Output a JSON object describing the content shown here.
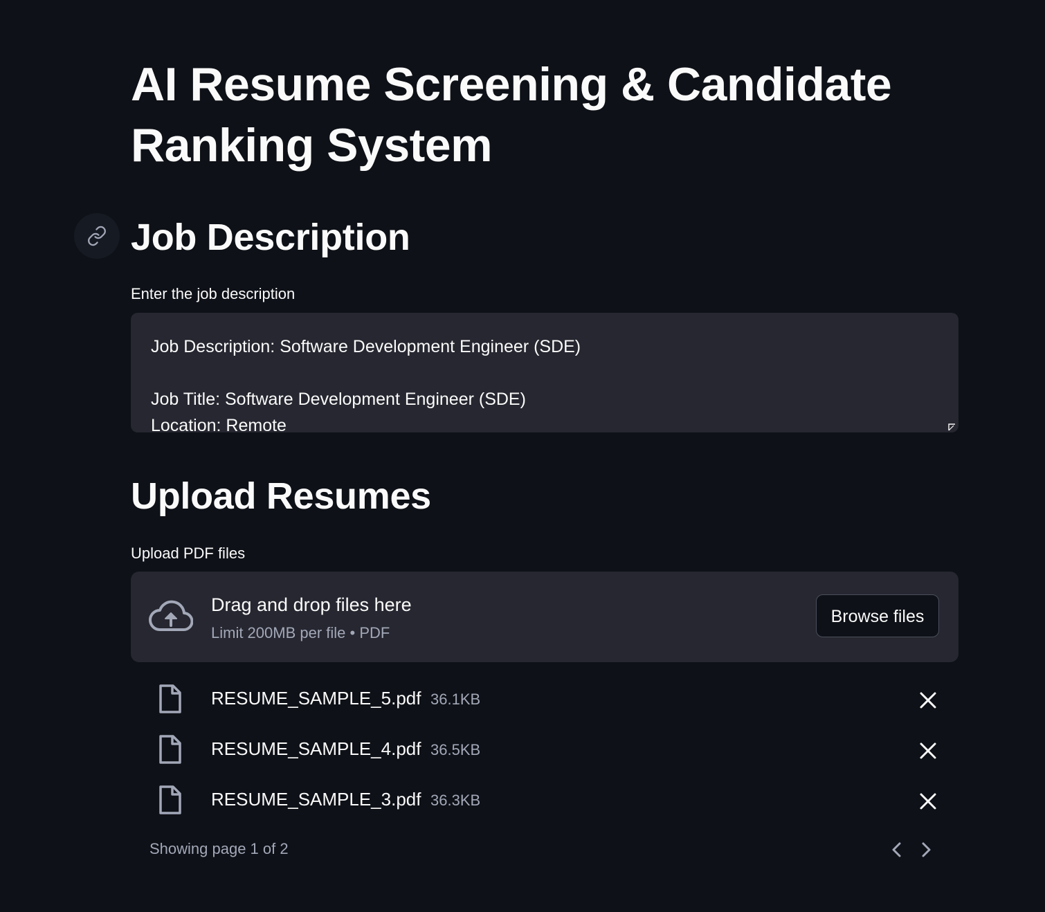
{
  "app": {
    "title": "AI Resume Screening & Candidate Ranking System"
  },
  "job_section": {
    "heading": "Job Description",
    "anchor_icon": "link-icon",
    "input_label": "Enter the job description",
    "textarea_value": "Job Description: Software Development Engineer (SDE)\n\nJob Title: Software Development Engineer (SDE)\nLocation: Remote"
  },
  "upload_section": {
    "heading": "Upload Resumes",
    "input_label": "Upload PDF files",
    "dropzone": {
      "icon": "cloud-upload-icon",
      "title": "Drag and drop files here",
      "subtitle": "Limit 200MB per file • PDF",
      "browse_label": "Browse files"
    },
    "files": [
      {
        "name": "RESUME_SAMPLE_5.pdf",
        "size": "36.1KB"
      },
      {
        "name": "RESUME_SAMPLE_4.pdf",
        "size": "36.5KB"
      },
      {
        "name": "RESUME_SAMPLE_3.pdf",
        "size": "36.3KB"
      }
    ],
    "file_icon": "file-icon",
    "remove_icon": "close-icon",
    "pagination": {
      "text": "Showing page 1 of 2",
      "current_page": 1,
      "total_pages": 2,
      "prev_icon": "chevron-left-icon",
      "next_icon": "chevron-right-icon"
    }
  },
  "colors": {
    "background": "#0e1117",
    "surface": "#262730",
    "text": "#fafafa",
    "muted_text": "#a3a8b8"
  }
}
